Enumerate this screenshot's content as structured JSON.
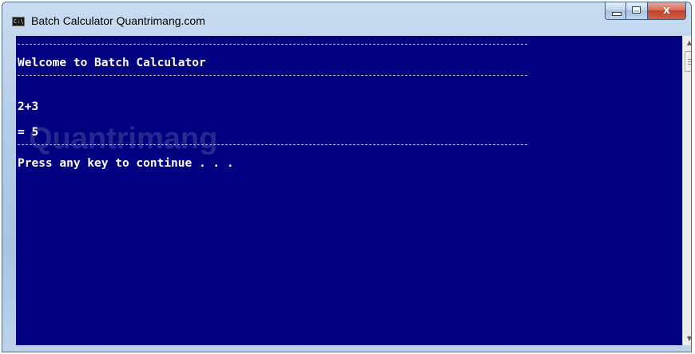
{
  "window": {
    "title": "Batch Calculator Quantrimang.com",
    "icon": "command-prompt-icon",
    "icon_text": "C:\\",
    "controls": {
      "minimize": "minimize-icon",
      "maximize": "maximize-icon",
      "close_glyph": "x"
    }
  },
  "console": {
    "background": "#000080",
    "text_color": "#ffffff",
    "lines": [
      {
        "kind": "rule"
      },
      {
        "kind": "text",
        "text": "Welcome to Batch Calculator"
      },
      {
        "kind": "rule"
      },
      {
        "kind": "blank"
      },
      {
        "kind": "text",
        "text": "2+3"
      },
      {
        "kind": "blank"
      },
      {
        "kind": "text",
        "text": "= 5"
      },
      {
        "kind": "rule"
      },
      {
        "kind": "text",
        "text": "Press any key to continue . . ."
      }
    ]
  },
  "watermark": {
    "text": "Quantrimang"
  },
  "scrollbar": {
    "up_glyph": "▲",
    "down_glyph": "▼"
  }
}
